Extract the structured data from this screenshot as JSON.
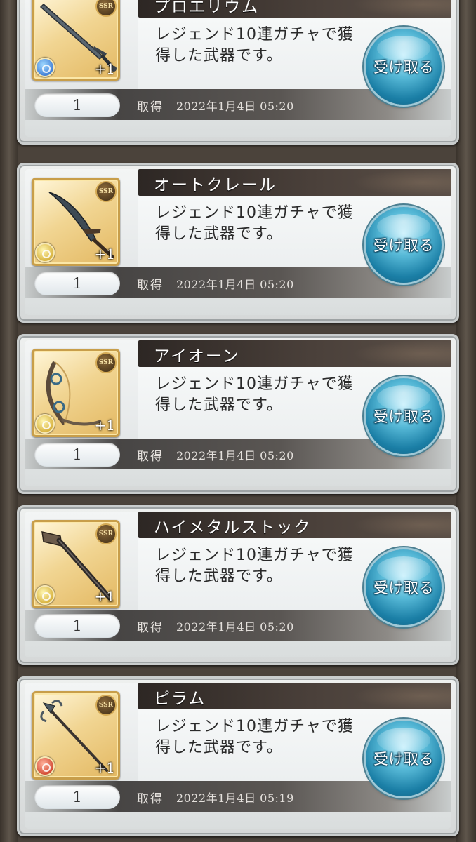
{
  "items": [
    {
      "name": "プロエリウム",
      "description_line1": "レジェンド10連ガチャで獲",
      "description_line2": "得した武器です。",
      "rarity": "SSR",
      "plus": "+1",
      "element": "water",
      "weapon_icon": "sword-icon",
      "quantity": "1",
      "acquired_label": "取得",
      "acquired_date": "2022年1月4日 05:20",
      "button_label": "受け取る"
    },
    {
      "name": "オートクレール",
      "description_line1": "レジェンド10連ガチャで獲",
      "description_line2": "得した武器です。",
      "rarity": "SSR",
      "plus": "+1",
      "element": "light",
      "weapon_icon": "blade-icon",
      "quantity": "1",
      "acquired_label": "取得",
      "acquired_date": "2022年1月4日 05:20",
      "button_label": "受け取る"
    },
    {
      "name": "アイオーン",
      "description_line1": "レジェンド10連ガチャで獲",
      "description_line2": "得した武器です。",
      "rarity": "SSR",
      "plus": "+1",
      "element": "light",
      "weapon_icon": "bow-icon",
      "quantity": "1",
      "acquired_label": "取得",
      "acquired_date": "2022年1月4日 05:20",
      "button_label": "受け取る"
    },
    {
      "name": "ハイメタルストック",
      "description_line1": "レジェンド10連ガチャで獲",
      "description_line2": "得した武器です。",
      "rarity": "SSR",
      "plus": "+1",
      "element": "light",
      "weapon_icon": "gun-icon",
      "quantity": "1",
      "acquired_label": "取得",
      "acquired_date": "2022年1月4日 05:20",
      "button_label": "受け取る"
    },
    {
      "name": "ピラム",
      "description_line1": "レジェンド10連ガチャで獲",
      "description_line2": "得した武器です。",
      "rarity": "SSR",
      "plus": "+1",
      "element": "fire",
      "weapon_icon": "spear-icon",
      "quantity": "1",
      "acquired_label": "取得",
      "acquired_date": "2022年1月4日 05:19",
      "button_label": "受け取る"
    }
  ]
}
